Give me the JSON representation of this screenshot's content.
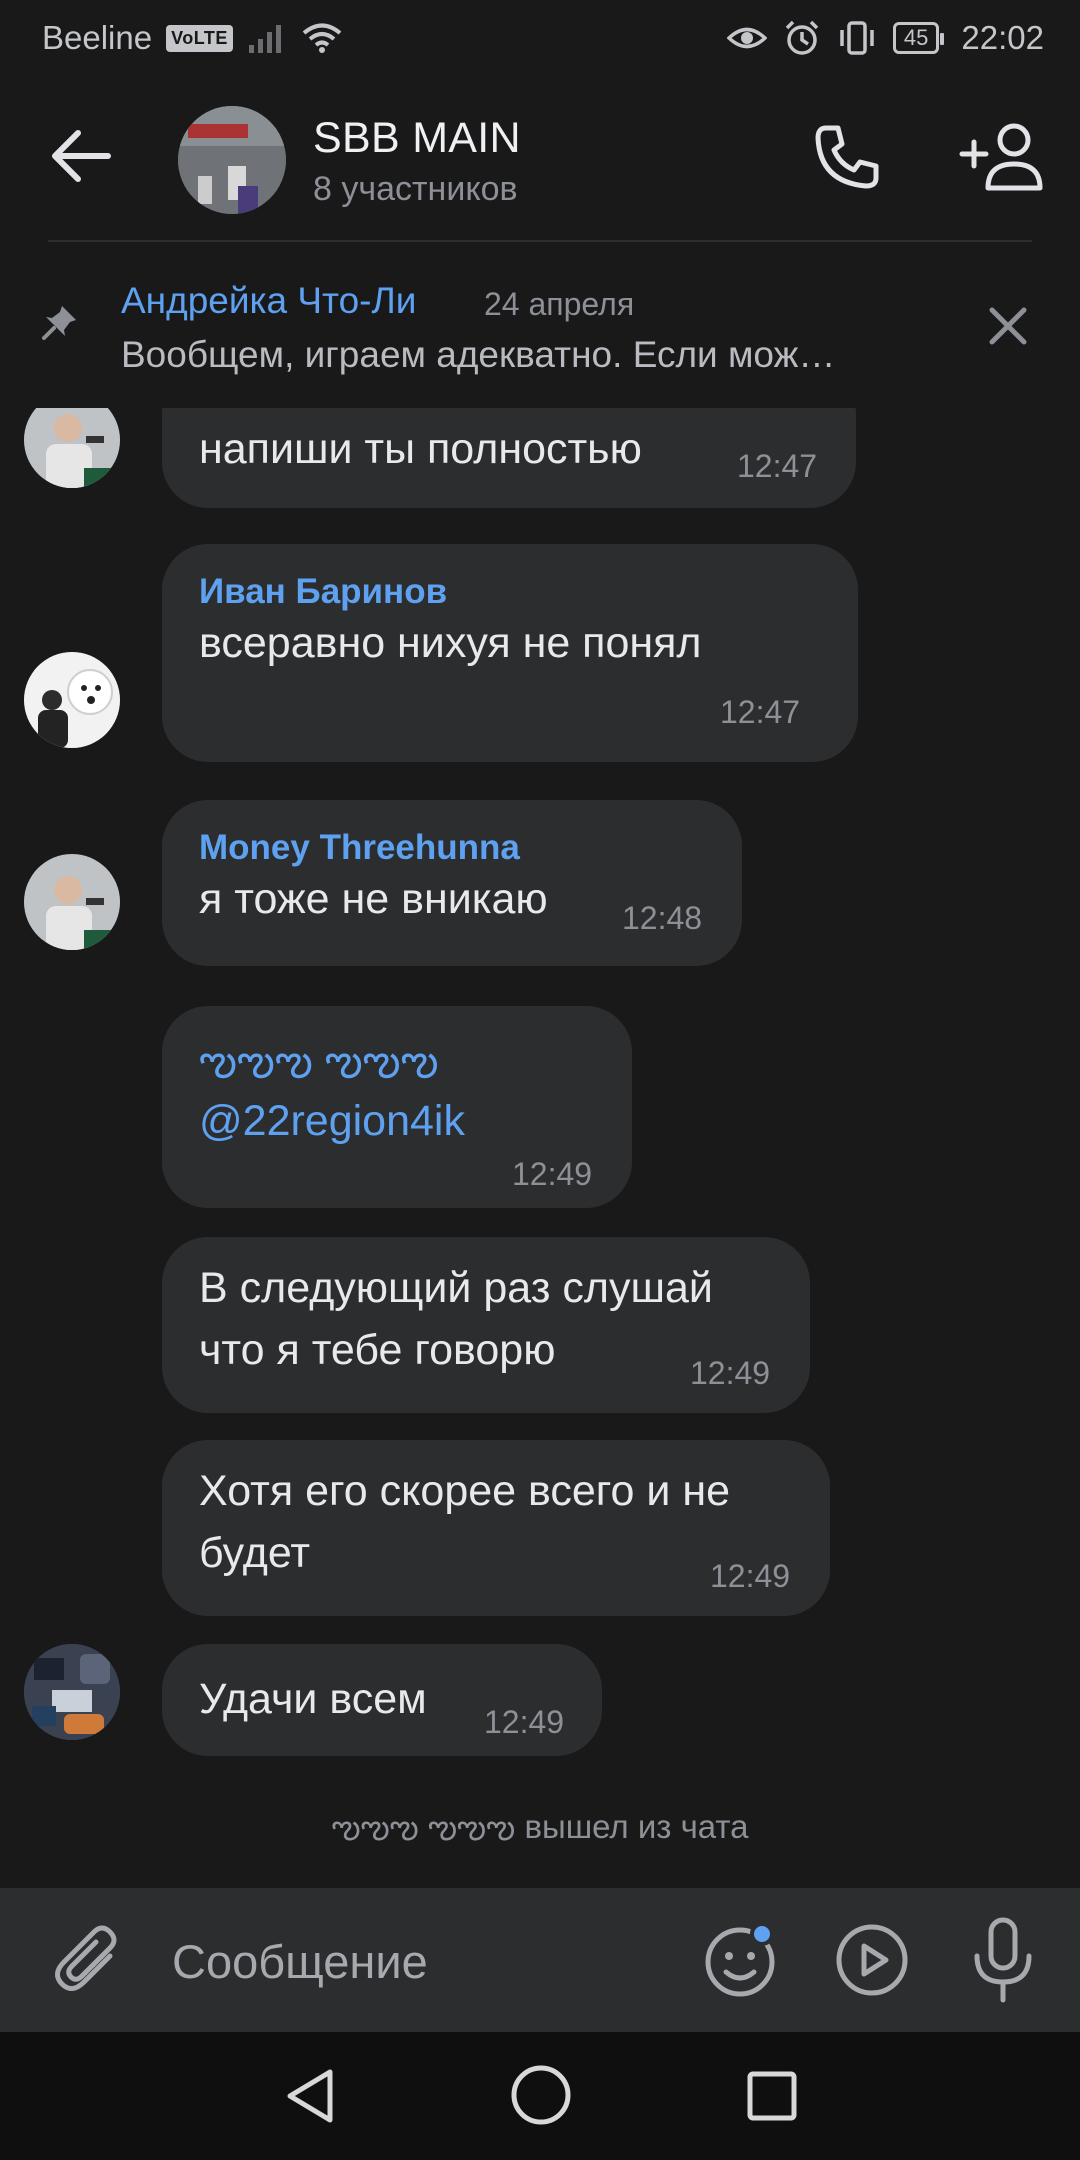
{
  "status_bar": {
    "carrier": "Beeline",
    "volte": "VoLTE",
    "battery": "45",
    "time": "22:02"
  },
  "header": {
    "title": "SBB MAIN",
    "subtitle": "8 участников",
    "icons": [
      "arrow-left-icon",
      "phone-icon",
      "add-user-icon"
    ]
  },
  "pinned": {
    "author": "Андрейка Что-Ли",
    "date": "24 апреля",
    "text": "Вообщем, играем адекватно. Если мож…"
  },
  "messages": [
    {
      "text": "напиши ты полностью",
      "time": "12:47"
    },
    {
      "sender": "Иван Баринов",
      "text": "всеравно нихуя не понял",
      "time": "12:47"
    },
    {
      "sender": "Money Threehunna",
      "text": "я тоже не вникаю",
      "time": "12:48"
    },
    {
      "line1": "ఌఌఌ ఌఌఌ",
      "line2": "@22region4ik",
      "time": "12:49"
    },
    {
      "line1": "В следующий раз слушай",
      "line2": "что я тебе говорю",
      "time": "12:49"
    },
    {
      "line1": "Хотя его скорее всего и не",
      "line2": "будет",
      "time": "12:49"
    },
    {
      "text": "Удачи всем",
      "time": "12:49"
    }
  ],
  "system_message": {
    "name": "ఌఌఌ ఌఌఌ",
    "text": "вышел из чата"
  },
  "composer": {
    "placeholder": "Сообщение"
  },
  "colors": {
    "background": "#19191a",
    "bubble": "#2c2d2f",
    "accent": "#5ea1f0",
    "muted": "#8d9096"
  }
}
